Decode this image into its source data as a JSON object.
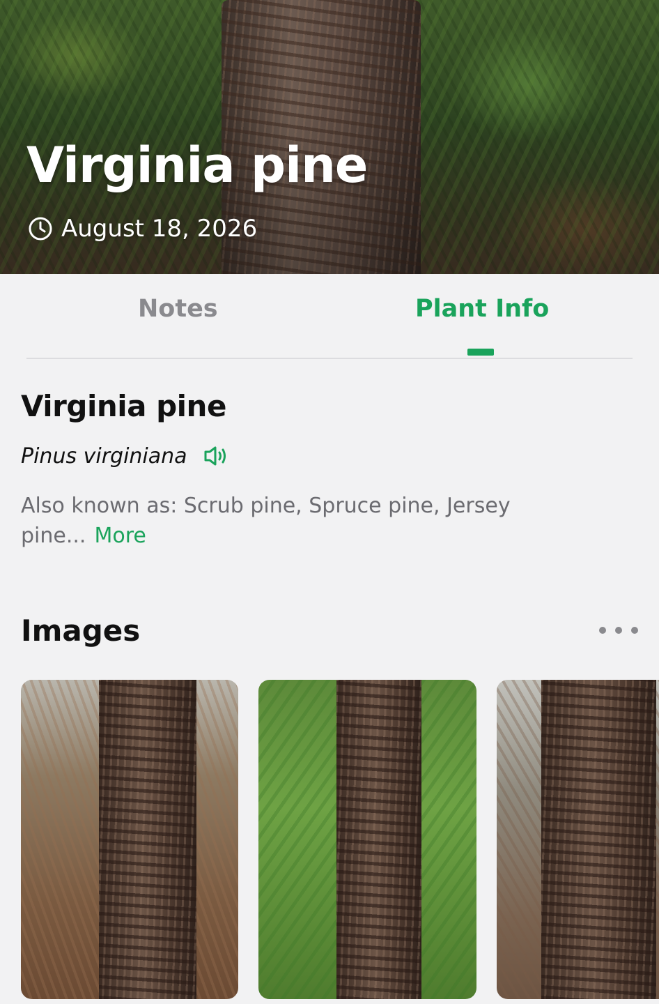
{
  "header": {
    "title": "Virginia pine",
    "date": "August 18, 2026"
  },
  "tabs": [
    {
      "label": "Notes",
      "active": false
    },
    {
      "label": "Plant Info",
      "active": true
    }
  ],
  "plant": {
    "common_name": "Virginia pine",
    "scientific_name": "Pinus virginiana",
    "also_known_as": "Also known as: Scrub pine, Spruce pine, Jersey pine...",
    "more_label": "More"
  },
  "images_section": {
    "title": "Images",
    "thumbnails": [
      "thumbnail-1",
      "thumbnail-2",
      "thumbnail-3"
    ]
  },
  "icons": {
    "date": "clock-icon",
    "pronounce": "speaker-icon",
    "menu": "more-options-icon"
  },
  "colors": {
    "accent": "#1aa35b",
    "inactive_tab": "#8a8a8e",
    "background": "#f2f2f3"
  }
}
